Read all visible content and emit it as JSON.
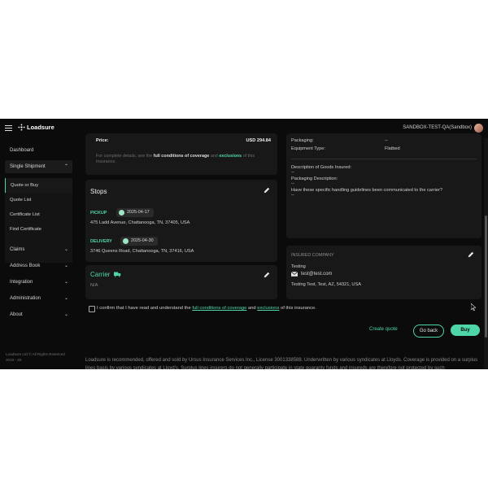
{
  "app": {
    "logo": "Loadsure",
    "environment": "SANDBOX-TEST-QA(Sandbox)"
  },
  "sidebar": {
    "items": [
      {
        "label": "Dashboard"
      },
      {
        "label": "Single Shipment"
      },
      {
        "label": "Claims"
      },
      {
        "label": "Address Book"
      },
      {
        "label": "Integration"
      },
      {
        "label": "Administration"
      },
      {
        "label": "About"
      }
    ],
    "sub_items": [
      {
        "label": "Quote or Buy"
      },
      {
        "label": "Quote List"
      },
      {
        "label": "Certificate List"
      },
      {
        "label": "Find Certificate"
      }
    ],
    "copyright": "Loadsure Ltd © All Rights Reserved 2019 - 25"
  },
  "price_card": {
    "label": "Price:",
    "value": "USD 294.84",
    "note_prefix": "For complete details, see the",
    "note_link1": "full conditions of coverage",
    "note_and": "and",
    "note_link2": "exclusions",
    "note_suffix": "of this",
    "note_line2": "insurance."
  },
  "stops": {
    "title": "Stops",
    "pickup_label": "PICKUP",
    "pickup_date": "2025-04-17",
    "pickup_address": "475 Ladd Avenue, Chattanooga, TN, 37405, USA",
    "delivery_label": "DELIVERY",
    "delivery_date": "2025-04-30",
    "delivery_address": "3746 Queens Road, Chattanooga, TN, 37416, USA"
  },
  "carrier": {
    "title": "Carrier",
    "value": "N/A"
  },
  "freight": {
    "packaging_label": "Packaging:",
    "packaging_value": "--",
    "equipment_label": "Equipment Type:",
    "equipment_value": "Flatbed",
    "goods_label": "Description of Goods Insured:",
    "goods_value": "--",
    "packaging_desc_label": "Packaging Description:",
    "packaging_desc_value": "--",
    "handling_label": "Have these specific handling guidelines been communicated to the carrier?",
    "handling_value": "--"
  },
  "insured": {
    "title": "INSURED COMPANY",
    "name": "Testing",
    "email": "test@test.com",
    "address": "Testing Test, Test, AZ, 54321, USA"
  },
  "confirm": {
    "prefix": "I confirm that I have read and understand the",
    "link1": "full conditions of coverage",
    "and": "and",
    "link2": "exclusions",
    "suffix": "of this insurance."
  },
  "actions": {
    "create_quote": "Create quote",
    "go_back": "Go back",
    "buy": "Buy"
  },
  "disclaimer": "Loadsure is recommended, offered and sold by Ursus Insurance Services Inc., License 3001338588. Underwritten by various syndicates at Lloyds. Coverage is provided on a surplus lines basis by various syndicates at Lloyd's. Surplus lines insurers do not generally participate in state guaranty funds and insureds are therefore not protected by such",
  "colors": {
    "accent": "#4fd6a8",
    "background": "#0b0b0b",
    "card": "#181818"
  }
}
